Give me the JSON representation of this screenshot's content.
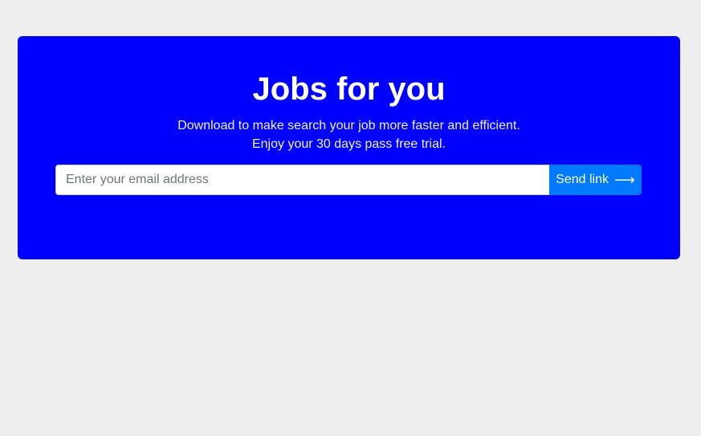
{
  "hero": {
    "title": "Jobs for you",
    "subtitle_line1": "Download to make search your job more faster and efficient.",
    "subtitle_line2": "Enjoy your 30 days pass free trial.",
    "background_color": "#0000ff"
  },
  "signup": {
    "email_value": "",
    "email_placeholder": "Enter your email address",
    "button_label": "Send link",
    "button_icon": "arrow-right-icon",
    "button_color": "#007bff"
  }
}
